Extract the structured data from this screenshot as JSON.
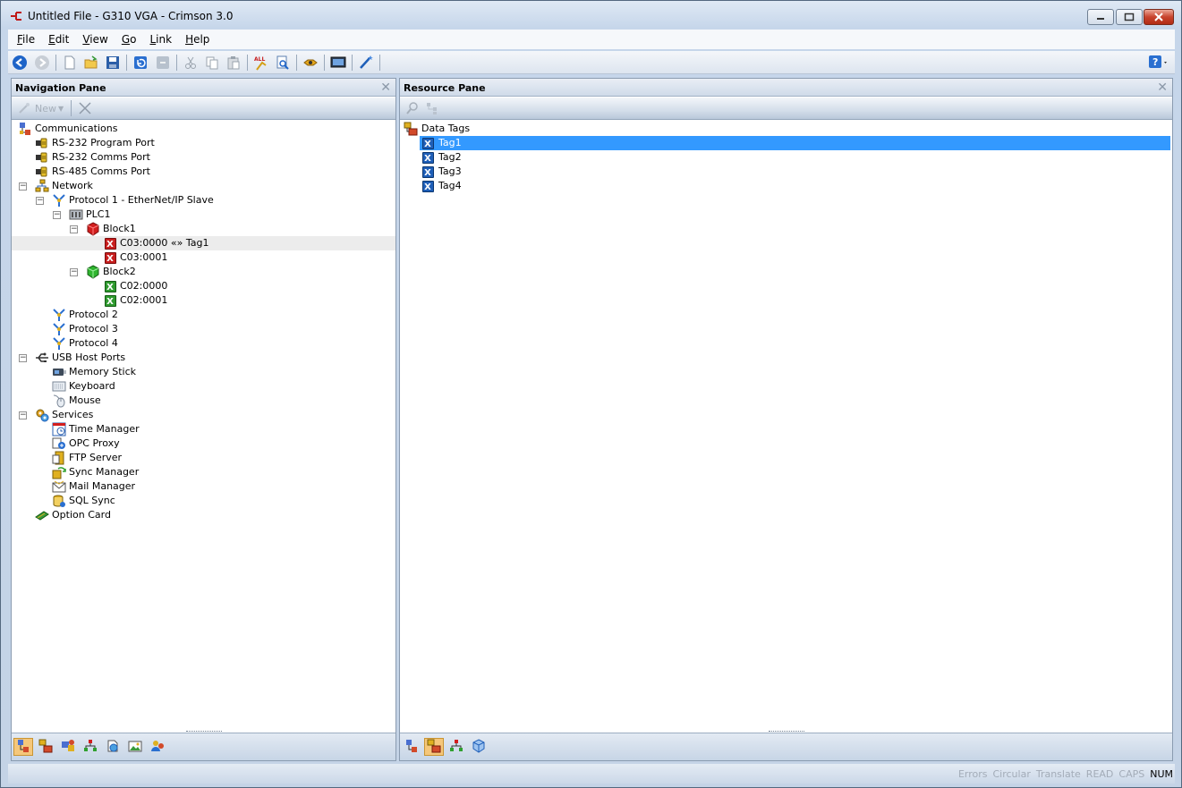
{
  "window": {
    "title": "Untitled File - G310 VGA - Crimson 3.0"
  },
  "menu": [
    {
      "accel": "F",
      "rest": "ile"
    },
    {
      "accel": "E",
      "rest": "dit"
    },
    {
      "accel": "V",
      "rest": "iew"
    },
    {
      "accel": "G",
      "rest": "o"
    },
    {
      "accel": "L",
      "rest": "ink"
    },
    {
      "accel": "H",
      "rest": "elp"
    }
  ],
  "toolbar": {
    "icons": [
      "back-icon",
      "forward-icon",
      "new-file-icon",
      "open-file-icon",
      "save-icon",
      "undo-icon",
      "redo-icon",
      "cut-icon",
      "copy-icon",
      "paste-icon",
      "find-all-icon",
      "find-icon",
      "link-icon",
      "monitor-icon",
      "wand-icon",
      "help-icon"
    ],
    "all_badge": "ALL"
  },
  "nav_pane": {
    "title": "Navigation Pane",
    "new_label": "New",
    "tree": [
      {
        "label": "Communications",
        "level": 0,
        "icon": "communications-icon",
        "expander": ""
      },
      {
        "label": "RS-232 Program Port",
        "level": 1,
        "icon": "port-icon",
        "expander": ""
      },
      {
        "label": "RS-232 Comms Port",
        "level": 1,
        "icon": "port-icon",
        "expander": ""
      },
      {
        "label": "RS-485 Comms Port",
        "level": 1,
        "icon": "port-icon",
        "expander": ""
      },
      {
        "label": "Network",
        "level": 1,
        "icon": "network-icon",
        "expander": "−"
      },
      {
        "label": "Protocol 1 - EtherNet/IP Slave",
        "level": 2,
        "icon": "protocol-icon",
        "expander": "−"
      },
      {
        "label": "PLC1",
        "level": 3,
        "icon": "plc-icon",
        "expander": "−"
      },
      {
        "label": "Block1",
        "level": 4,
        "icon": "block-red-icon",
        "expander": "−"
      },
      {
        "label": "C03:0000 «» Tag1",
        "level": 5,
        "icon": "x-red-icon",
        "expander": "",
        "highlight": true
      },
      {
        "label": "C03:0001",
        "level": 5,
        "icon": "x-red-icon",
        "expander": ""
      },
      {
        "label": "Block2",
        "level": 4,
        "icon": "block-green-icon",
        "expander": "−"
      },
      {
        "label": "C02:0000",
        "level": 5,
        "icon": "x-green-icon",
        "expander": ""
      },
      {
        "label": "C02:0001",
        "level": 5,
        "icon": "x-green-icon",
        "expander": ""
      },
      {
        "label": "Protocol 2",
        "level": 2,
        "icon": "protocol-icon",
        "expander": ""
      },
      {
        "label": "Protocol 3",
        "level": 2,
        "icon": "protocol-icon",
        "expander": ""
      },
      {
        "label": "Protocol 4",
        "level": 2,
        "icon": "protocol-icon",
        "expander": ""
      },
      {
        "label": "USB Host Ports",
        "level": 1,
        "icon": "usb-icon",
        "expander": "−"
      },
      {
        "label": "Memory Stick",
        "level": 2,
        "icon": "memory-stick-icon",
        "expander": ""
      },
      {
        "label": "Keyboard",
        "level": 2,
        "icon": "keyboard-icon",
        "expander": ""
      },
      {
        "label": "Mouse",
        "level": 2,
        "icon": "mouse-icon",
        "expander": ""
      },
      {
        "label": "Services",
        "level": 1,
        "icon": "services-icon",
        "expander": "−"
      },
      {
        "label": "Time Manager",
        "level": 2,
        "icon": "time-manager-icon",
        "expander": ""
      },
      {
        "label": "OPC Proxy",
        "level": 2,
        "icon": "opc-proxy-icon",
        "expander": ""
      },
      {
        "label": "FTP Server",
        "level": 2,
        "icon": "ftp-server-icon",
        "expander": ""
      },
      {
        "label": "Sync Manager",
        "level": 2,
        "icon": "sync-manager-icon",
        "expander": ""
      },
      {
        "label": "Mail Manager",
        "level": 2,
        "icon": "mail-manager-icon",
        "expander": ""
      },
      {
        "label": "SQL Sync",
        "level": 2,
        "icon": "sql-sync-icon",
        "expander": ""
      },
      {
        "label": "Option Card",
        "level": 1,
        "icon": "option-card-icon",
        "expander": ""
      }
    ],
    "footer_icons": [
      "comms-view-icon",
      "tags-view-icon",
      "display-view-icon",
      "program-view-icon",
      "web-view-icon",
      "image-view-icon",
      "user-view-icon"
    ]
  },
  "res_pane": {
    "title": "Resource Pane",
    "tree": [
      {
        "label": "Data Tags",
        "level": 0,
        "icon": "data-tags-icon"
      },
      {
        "label": "Tag1",
        "level": 1,
        "icon": "x-blue-icon",
        "selected": true
      },
      {
        "label": "Tag2",
        "level": 1,
        "icon": "x-blue-icon"
      },
      {
        "label": "Tag3",
        "level": 1,
        "icon": "x-blue-icon"
      },
      {
        "label": "Tag4",
        "level": 1,
        "icon": "x-blue-icon"
      }
    ],
    "footer_icons": [
      "comms-view-icon",
      "tags-view-icon",
      "program-view-icon",
      "cube-view-icon"
    ]
  },
  "status": [
    {
      "label": "Errors",
      "on": false
    },
    {
      "label": "Circular",
      "on": false
    },
    {
      "label": "Translate",
      "on": false
    },
    {
      "label": "READ",
      "on": false
    },
    {
      "label": "CAPS",
      "on": false
    },
    {
      "label": "NUM",
      "on": true
    }
  ],
  "colors": {
    "selection": "#3399ff",
    "close_button": "#c8432d"
  }
}
